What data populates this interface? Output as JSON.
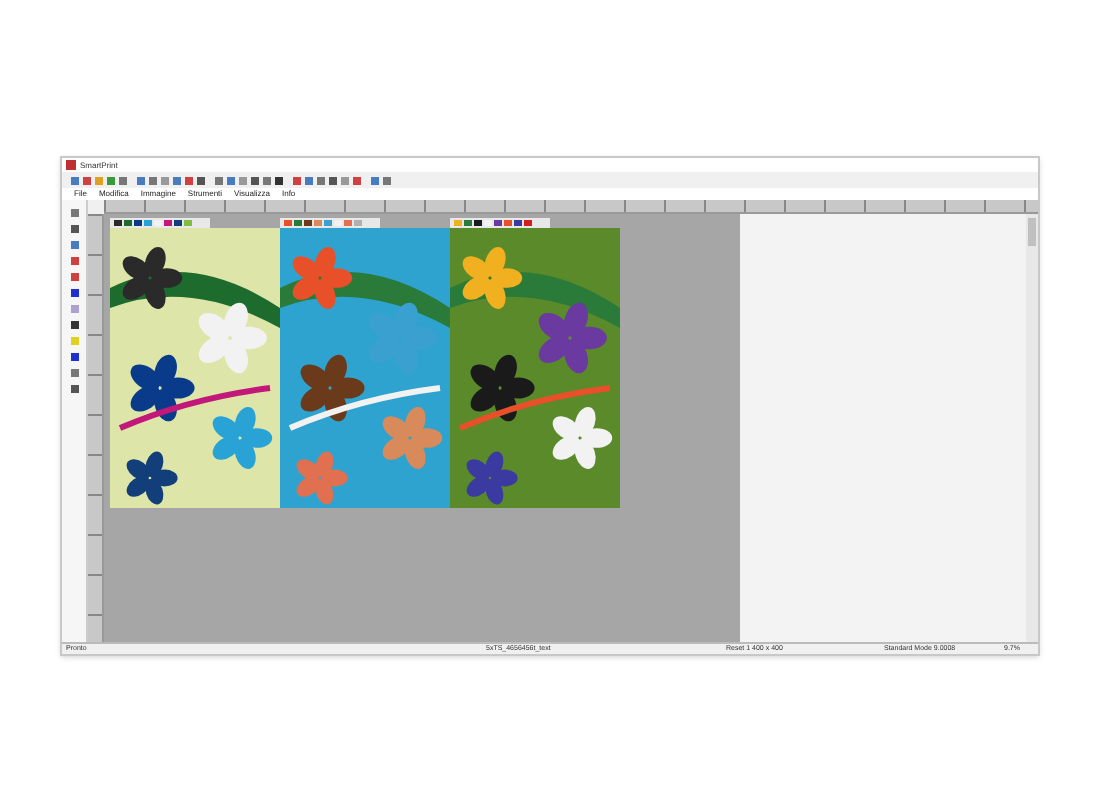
{
  "window": {
    "title": "SmartPrint"
  },
  "menu": [
    "File",
    "Modifica",
    "Immagine",
    "Strumenti",
    "Visualizza",
    "Info"
  ],
  "panels": [
    {
      "kind": "picture",
      "swatches": [
        {
          "color": "#2a2a2a"
        },
        {
          "color": "#1e6b2e"
        },
        {
          "color": "#0a3a8a"
        },
        {
          "color": "#29a3d6"
        },
        {
          "color": "#f2f2f2"
        },
        {
          "color": "#c2187a"
        },
        {
          "color": "#123e7a"
        },
        {
          "color": "#7fbf3f"
        }
      ]
    },
    {
      "kind": "picture",
      "swatches": [
        {
          "color": "#e8502a"
        },
        {
          "color": "#2a7a3a"
        },
        {
          "color": "#6a3a1a"
        },
        {
          "color": "#d98a5a"
        },
        {
          "color": "#3aa0d0"
        },
        {
          "color": "#f2f2f2"
        },
        {
          "color": "#e07050"
        },
        {
          "color": "#b0b0b0"
        }
      ]
    },
    {
      "kind": "picture",
      "swatches": [
        {
          "color": "#f0b020"
        },
        {
          "color": "#2a7a3a"
        },
        {
          "color": "#1a1a1a"
        },
        {
          "color": "#f2f2f2"
        },
        {
          "color": "#6a3aa0"
        },
        {
          "color": "#e8502a"
        },
        {
          "color": "#3a3aa0"
        },
        {
          "color": "#d02020"
        }
      ]
    }
  ],
  "status": [
    "Pronto",
    "5xTS_4656456t_text",
    "Reset 1 400 x 400",
    "Standard Mode 9.0008",
    "9.7%"
  ]
}
